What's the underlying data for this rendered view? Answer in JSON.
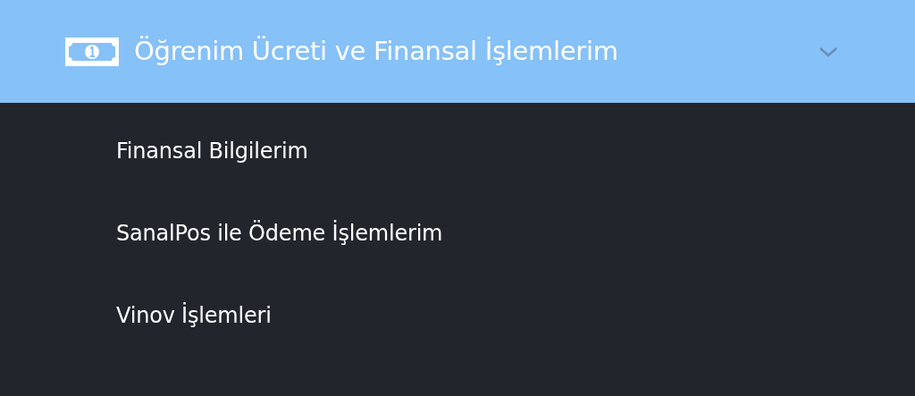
{
  "menu": {
    "title": "Öğrenim Ücreti ve Finansal İşlemlerim",
    "expanded": true,
    "items": [
      {
        "label": "Finansal Bilgilerim"
      },
      {
        "label": "SanalPos ile Ödeme İşlemlerim"
      },
      {
        "label": "Vinov İşlemleri"
      }
    ]
  }
}
